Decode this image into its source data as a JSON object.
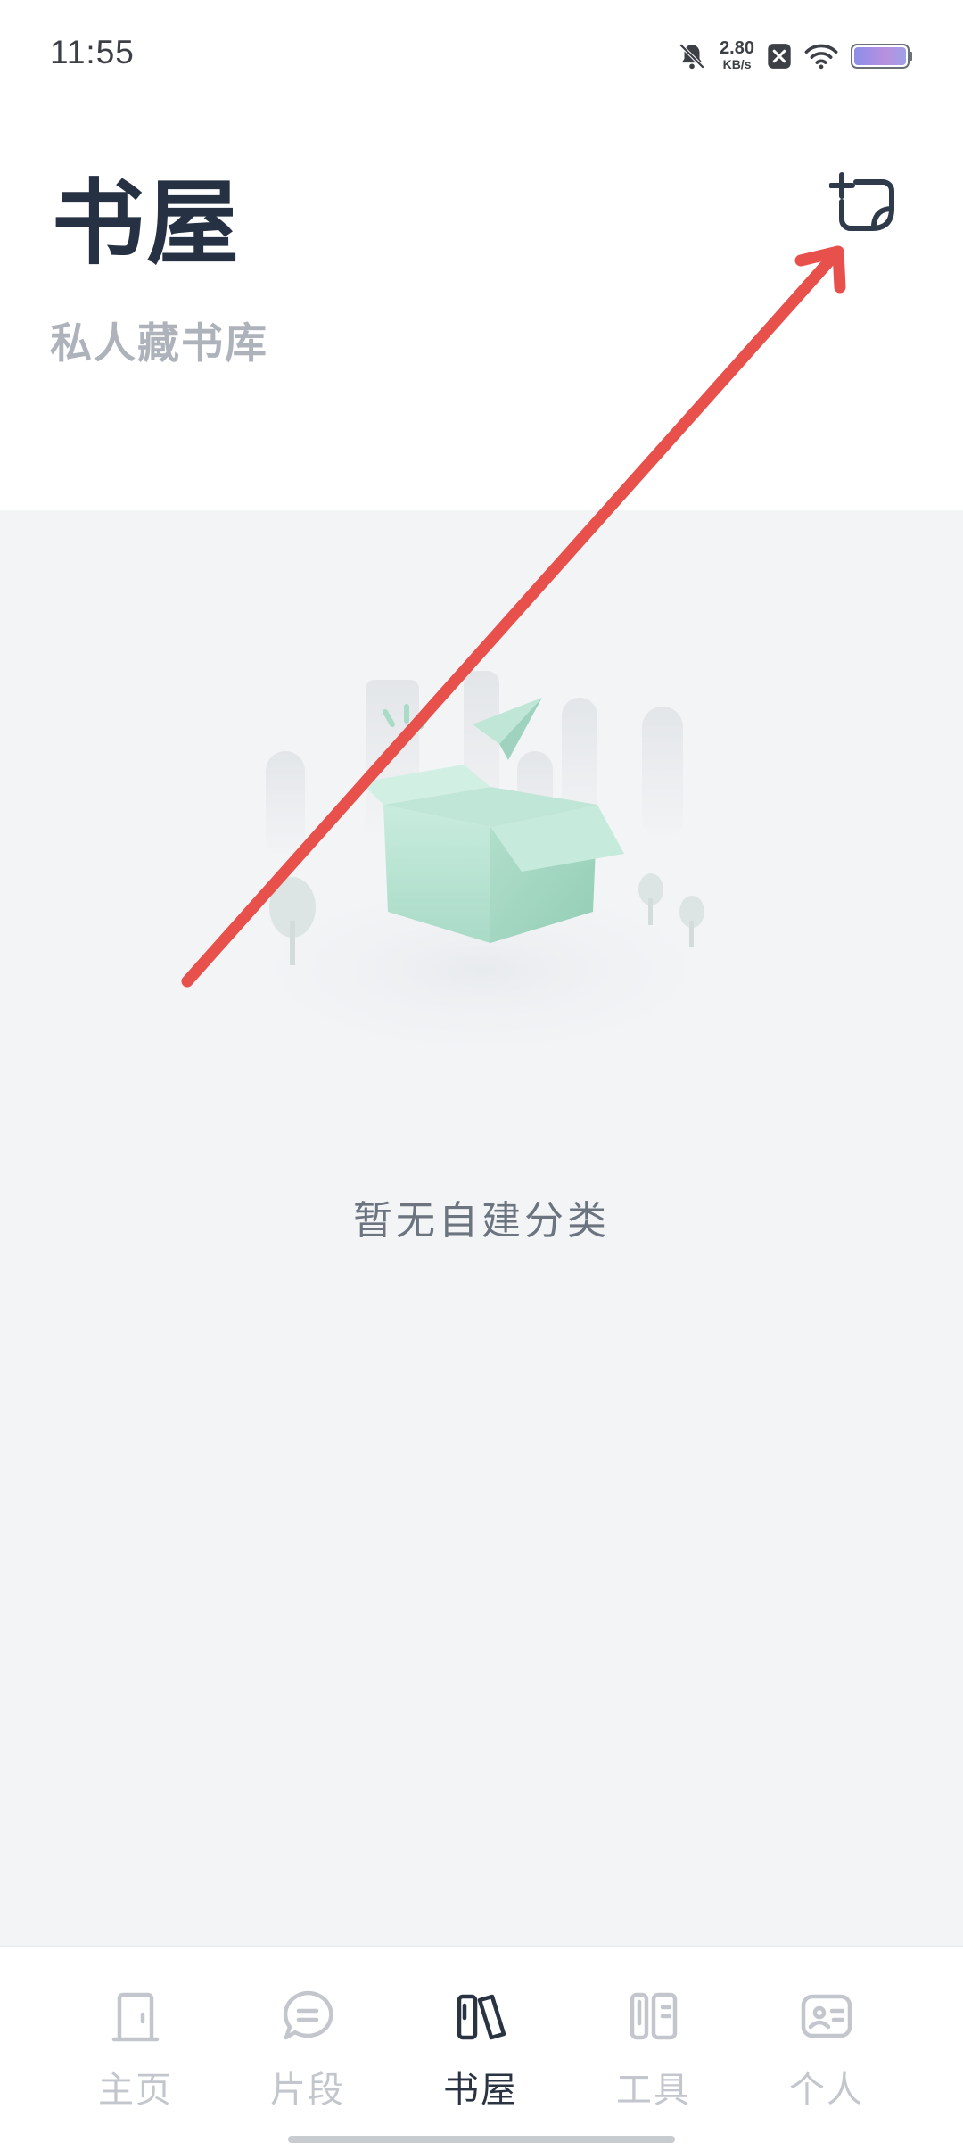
{
  "status_bar": {
    "time": "11:55",
    "speed_value": "2.80",
    "speed_unit": "KB/s",
    "icons": [
      "bell-off-icon",
      "close-box-icon",
      "wifi-icon",
      "battery-icon"
    ]
  },
  "header": {
    "title": "书屋",
    "subtitle": "私人藏书库",
    "add_button_icon": "add-note-icon"
  },
  "main": {
    "empty_message": "暂无自建分类",
    "illustration": "empty-box-illustration"
  },
  "nav": {
    "items": [
      {
        "label": "主页",
        "icon": "door-icon",
        "active": false
      },
      {
        "label": "片段",
        "icon": "chat-bubble-icon",
        "active": false
      },
      {
        "label": "书屋",
        "icon": "books-icon",
        "active": true
      },
      {
        "label": "工具",
        "icon": "tools-icon",
        "active": false
      },
      {
        "label": "个人",
        "icon": "id-card-icon",
        "active": false
      }
    ]
  },
  "colors": {
    "title": "#263244",
    "subtitle": "#aeb3bb",
    "background": "#f3f4f6",
    "annotation_arrow": "#e8504b",
    "nav_active": "#2a3342",
    "nav_inactive": "#c3c7cd",
    "box": "#a8dcc7"
  }
}
